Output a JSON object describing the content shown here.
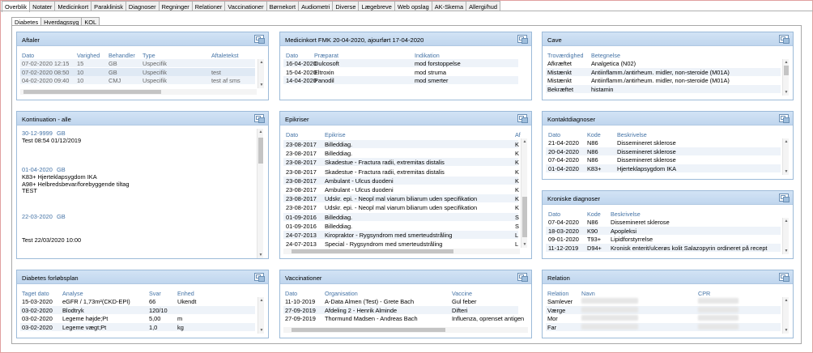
{
  "top_tabs": [
    "Overblik",
    "Notater",
    "Medicinkort",
    "Paraklinisk",
    "Diagnoser",
    "Regninger",
    "Relationer",
    "Vaccinationer",
    "Børnekort",
    "Audiometri",
    "Diverse",
    "Lægebreve",
    "Web opslag",
    "AK-Skema",
    "Allergi/hud"
  ],
  "sub_tabs": [
    "Diabetes",
    "Hverdagssyg",
    "KOL"
  ],
  "aftaler": {
    "title": "Aftaler",
    "headers": [
      "Dato",
      "Varighed",
      "Behandler",
      "Type",
      "Aftaletekst"
    ],
    "rows": [
      [
        "07-02-2020 12:15",
        "15",
        "GB",
        "Uspecifik",
        ""
      ],
      [
        "07-02-2020 08:50",
        "10",
        "GB",
        "Uspecifik",
        "test"
      ],
      [
        "04-02-2020 09:40",
        "10",
        "CMJ",
        "Uspecifik",
        "test af sms"
      ]
    ]
  },
  "medicin": {
    "title": "Medicinkort FMK 20-04-2020, ajourført 17-04-2020",
    "headers": [
      "Dato",
      "Præparat",
      "Indikation"
    ],
    "rows": [
      [
        "16-04-2020",
        "Dulcosoft",
        "mod forstoppelse"
      ],
      [
        "15-04-2020",
        "Eltroxin",
        "mod struma"
      ],
      [
        "14-04-2020",
        "Panodil",
        "mod smerter"
      ]
    ]
  },
  "cave": {
    "title": "Cave",
    "headers": [
      "Troværdighed",
      "Betegnelse"
    ],
    "rows": [
      [
        "Afkræftet",
        "Analgetica (N02)"
      ],
      [
        "Mistænkt",
        "Antiinflamm./antirheum. midler, non-steroide (M01A)"
      ],
      [
        "Mistænkt",
        "Antiinflamm./antirheum. midler, non-steroide (M01A)"
      ],
      [
        "Bekræftet",
        "histamin"
      ]
    ]
  },
  "kontinuation": {
    "title": "Kontinuation - alle",
    "entries": [
      {
        "date": "30-12-9999",
        "user": "GB",
        "lines": [
          "Test 08:54 01/12/2019"
        ]
      },
      {
        "date": "01-04-2020",
        "user": "GB",
        "lines": [
          "K83+   Hjerteklapsygdom IKA",
          "A98+   Helbredsbevar/forebyggende tiltag",
          "TEST"
        ]
      },
      {
        "date": "22-03-2020",
        "user": "GB",
        "lines": []
      },
      {
        "date": "",
        "user": "",
        "lines": [
          "Test 22/03/2020 10:00"
        ]
      }
    ]
  },
  "epikriser": {
    "title": "Epikriser",
    "headers": [
      "Dato",
      "Epikrise",
      "Af"
    ],
    "rows": [
      [
        "23-08-2017",
        "Billeddiag.",
        "K"
      ],
      [
        "23-08-2017",
        "Billeddiag.",
        "K"
      ],
      [
        "23-08-2017",
        "Skadestue - Fractura radii, extremitas distalis",
        "K"
      ],
      [
        "23-08-2017",
        "Skadestue - Fractura radii, extremitas distalis",
        "K"
      ],
      [
        "23-08-2017",
        "Ambulant - Ulcus duodeni",
        "K"
      ],
      [
        "23-08-2017",
        "Ambulant - Ulcus duodeni",
        "K"
      ],
      [
        "23-08-2017",
        "Udskr. epi. - Neopl mal viarum biliarum uden specifikation",
        "K"
      ],
      [
        "23-08-2017",
        "Udskr. epi. - Neopl mal viarum biliarum uden specifikation",
        "K"
      ],
      [
        "01-09-2016",
        "Billeddiag.",
        "S"
      ],
      [
        "01-09-2016",
        "Billeddiag.",
        "S"
      ],
      [
        "24-07-2013",
        "Kiropraktor - Rygsyndrom med smerteudstråling",
        "L"
      ],
      [
        "24-07-2013",
        "Special - Rygsyndrom med smerteudstråling",
        "L"
      ]
    ]
  },
  "kontakt": {
    "title": "Kontaktdiagnoser",
    "headers": [
      "Dato",
      "Kode",
      "Beskrivelse"
    ],
    "rows": [
      [
        "21-04-2020",
        "N86",
        "Dissemineret sklerose"
      ],
      [
        "20-04-2020",
        "N86",
        "Dissemineret sklerose"
      ],
      [
        "07-04-2020",
        "N86",
        "Dissemineret sklerose"
      ],
      [
        "01-04-2020",
        "K83+",
        "Hjerteklapsygdom IKA"
      ]
    ]
  },
  "kroniske": {
    "title": "Kroniske diagnoser",
    "headers": [
      "Dato",
      "Kode",
      "Beskrivelse"
    ],
    "rows": [
      [
        "07-04-2020",
        "N86",
        "Dissemineret sklerose"
      ],
      [
        "18-03-2020",
        "K90",
        "Apopleksi"
      ],
      [
        "09-01-2020",
        "T93+",
        "Lipidforstyrrelse"
      ],
      [
        "11-12-2019",
        "D94+",
        "Kronisk enterit/ulcerøs kolit Salazopyrin ordineret på recept"
      ]
    ]
  },
  "diabetes": {
    "title": "Diabetes forløbsplan",
    "headers": [
      "Taget dato",
      "Analyse",
      "Svar",
      "Enhed"
    ],
    "rows": [
      [
        "15-03-2020",
        "eGFR / 1,73m²(CKD-EPI)",
        "66",
        "Ukendt"
      ],
      [
        "03-02-2020",
        "Blodtryk",
        "120/10",
        ""
      ],
      [
        "03-02-2020",
        "Legeme højde;Pt",
        "5,00",
        "m"
      ],
      [
        "03-02-2020",
        "Legeme vægt;Pt",
        "1,0",
        "kg"
      ]
    ]
  },
  "vacc": {
    "title": "Vaccinationer",
    "headers": [
      "Dato",
      "Organisation",
      "Vaccine"
    ],
    "rows": [
      [
        "11-10-2019",
        "A-Data Almen (Test)  - Grete Bach",
        "Gul feber"
      ],
      [
        "27-09-2019",
        "Afdeling 2  - Henrik Alminde",
        "Difteri"
      ],
      [
        "27-09-2019",
        "Thormund  Madsen - Andreas Bach",
        "Influenza, oprenset antigen"
      ]
    ]
  },
  "relation": {
    "title": "Relation",
    "headers": [
      "Relation",
      "Navn",
      "CPR"
    ],
    "rows": [
      [
        "Samlever",
        "",
        ""
      ],
      [
        "Værge",
        "",
        ""
      ],
      [
        "Mor",
        "",
        ""
      ],
      [
        "Far",
        "",
        ""
      ]
    ]
  }
}
